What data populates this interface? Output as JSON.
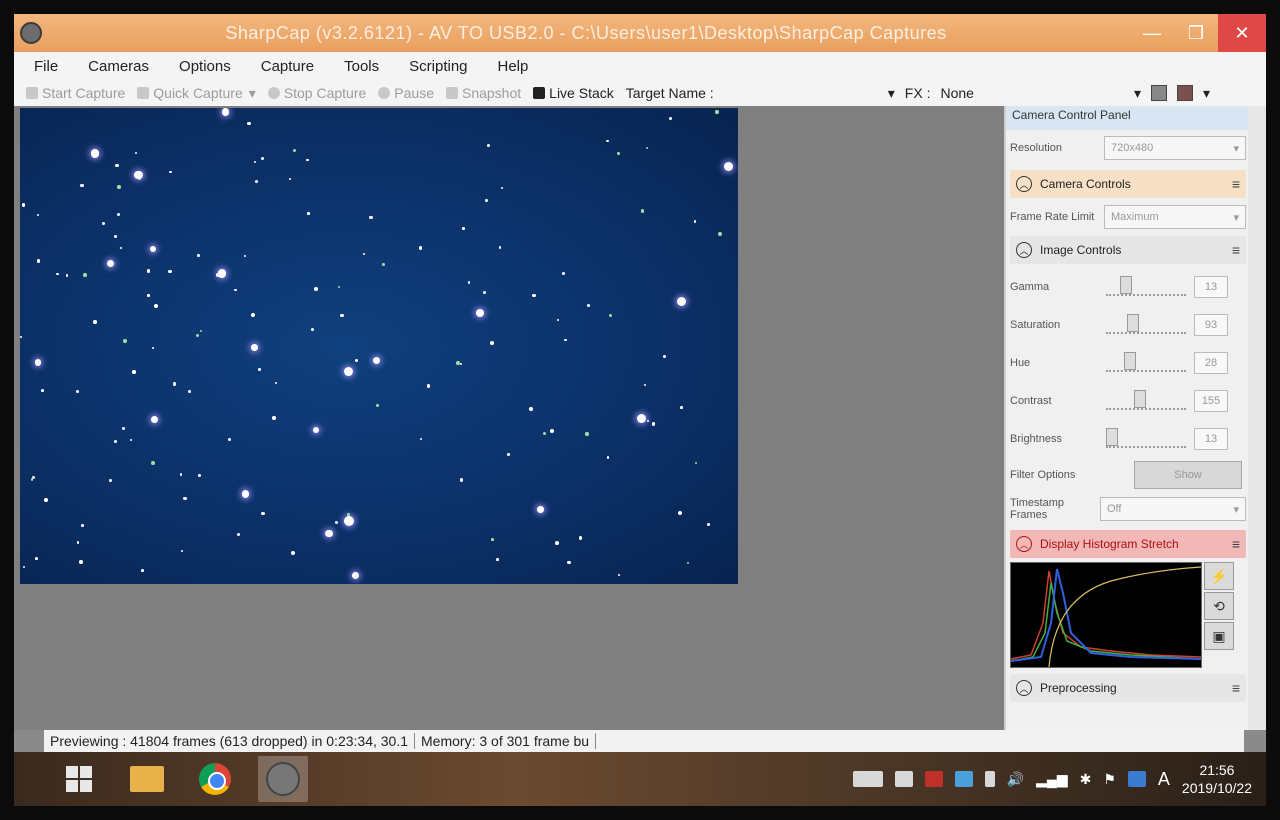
{
  "window": {
    "title": "SharpCap (v3.2.6121) - AV TO USB2.0 - C:\\Users\\user1\\Desktop\\SharpCap Captures",
    "controls": [
      "—",
      "❐",
      "✕"
    ]
  },
  "menu": [
    "File",
    "Cameras",
    "Options",
    "Capture",
    "Tools",
    "Scripting",
    "Help"
  ],
  "toolbar": {
    "start_capture": "Start Capture",
    "quick_capture": "Quick Capture",
    "stop_capture": "Stop Capture",
    "pause": "Pause",
    "snapshot": "Snapshot",
    "live_stack": "Live Stack",
    "target_name": "Target Name :",
    "fx_label": "FX :",
    "fx_value": "None"
  },
  "panel": {
    "title": "Camera Control Panel",
    "resolution_label": "Resolution",
    "resolution_value": "720x480",
    "camera_controls": "Camera Controls",
    "frame_rate_label": "Frame Rate Limit",
    "frame_rate_value": "Maximum",
    "image_controls": "Image Controls",
    "sliders": [
      {
        "label": "Gamma",
        "value": "13",
        "pos": 0.2
      },
      {
        "label": "Saturation",
        "value": "93",
        "pos": 0.3
      },
      {
        "label": "Hue",
        "value": "28",
        "pos": 0.25
      },
      {
        "label": "Contrast",
        "value": "155",
        "pos": 0.4
      },
      {
        "label": "Brightness",
        "value": "13",
        "pos": 0.0
      }
    ],
    "filter_options_label": "Filter Options",
    "filter_show": "Show",
    "timestamp_label": "Timestamp Frames",
    "timestamp_value": "Off",
    "histogram_stretch": "Display Histogram Stretch",
    "preprocessing": "Preprocessing"
  },
  "status": {
    "preview": "Previewing : 41804 frames (613 dropped) in 0:23:34, 30.1",
    "memory": "Memory: 3 of 301 frame bu"
  },
  "taskbar": {
    "time": "21:56",
    "date": "2019/10/22",
    "ime": "A"
  },
  "colors": {
    "titlebar": "#e99f5e",
    "preview_bg": "#0b2f66",
    "hist_section": "#f2b7b7"
  }
}
